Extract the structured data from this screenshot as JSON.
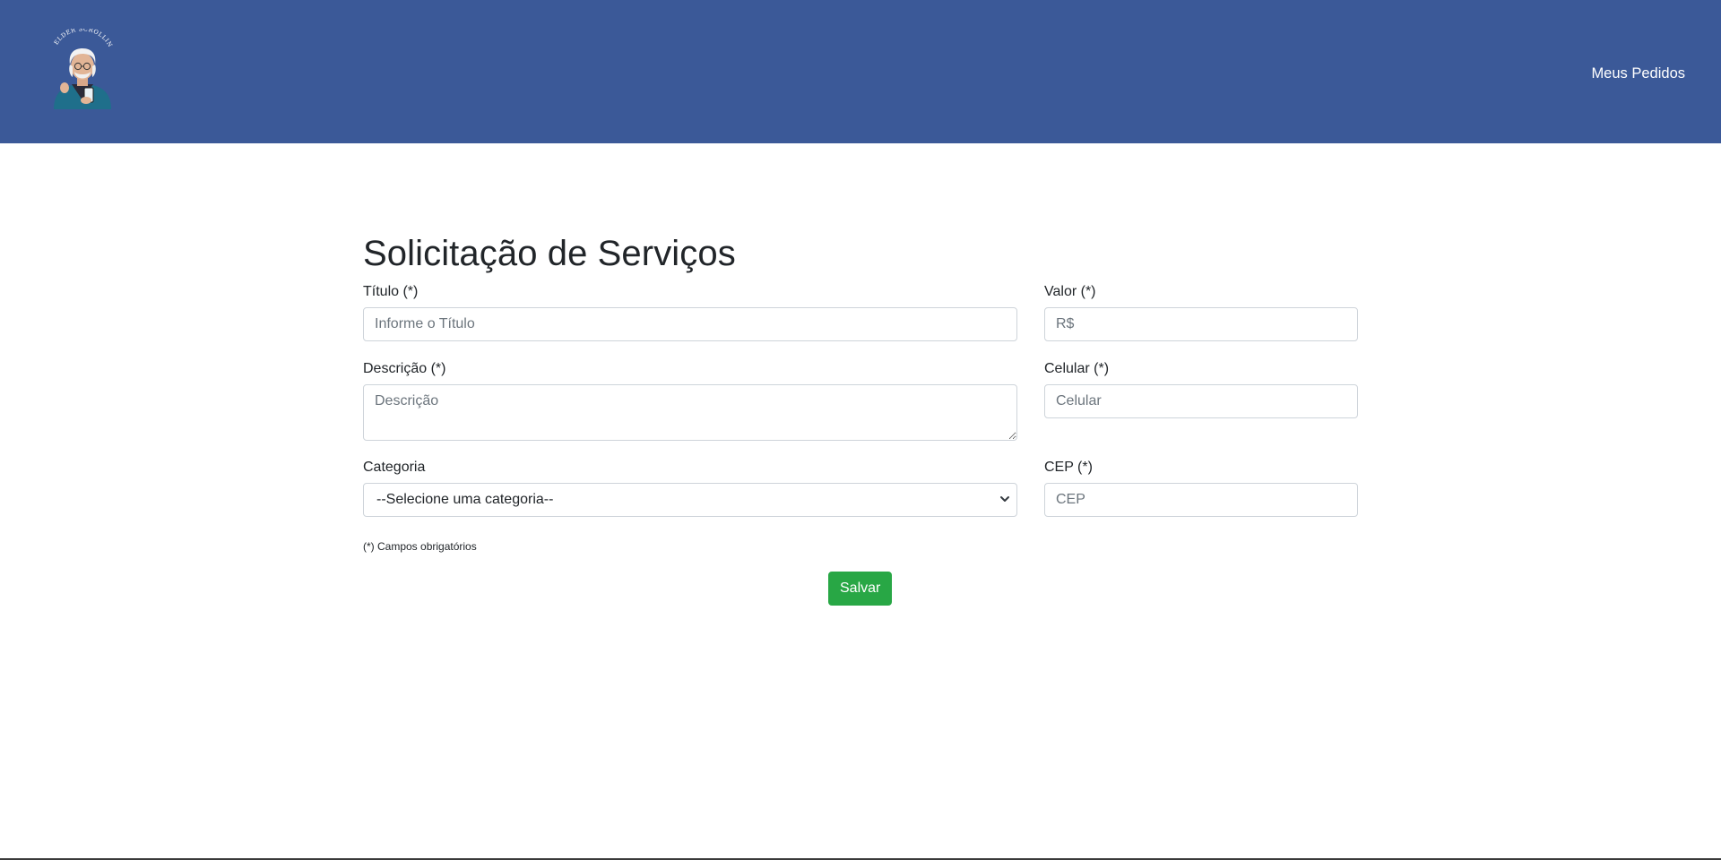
{
  "header": {
    "logo_alt": "ELDER SCROLLING",
    "nav_link": "Meus Pedidos"
  },
  "form": {
    "title": "Solicitação de Serviços",
    "titulo": {
      "label": "Título (*)",
      "placeholder": "Informe o Título"
    },
    "valor": {
      "label": "Valor (*)",
      "placeholder": "R$"
    },
    "descricao": {
      "label": "Descrição (*)",
      "placeholder": "Descrição"
    },
    "celular": {
      "label": "Celular (*)",
      "placeholder": "Celular"
    },
    "categoria": {
      "label": "Categoria",
      "selected": "--Selecione uma categoria--"
    },
    "cep": {
      "label": "CEP (*)",
      "placeholder": "CEP"
    },
    "note": "(*) Campos obrigatórios",
    "save_label": "Salvar"
  },
  "colors": {
    "header_bg": "#3b5998",
    "save_button": "#28a745"
  }
}
